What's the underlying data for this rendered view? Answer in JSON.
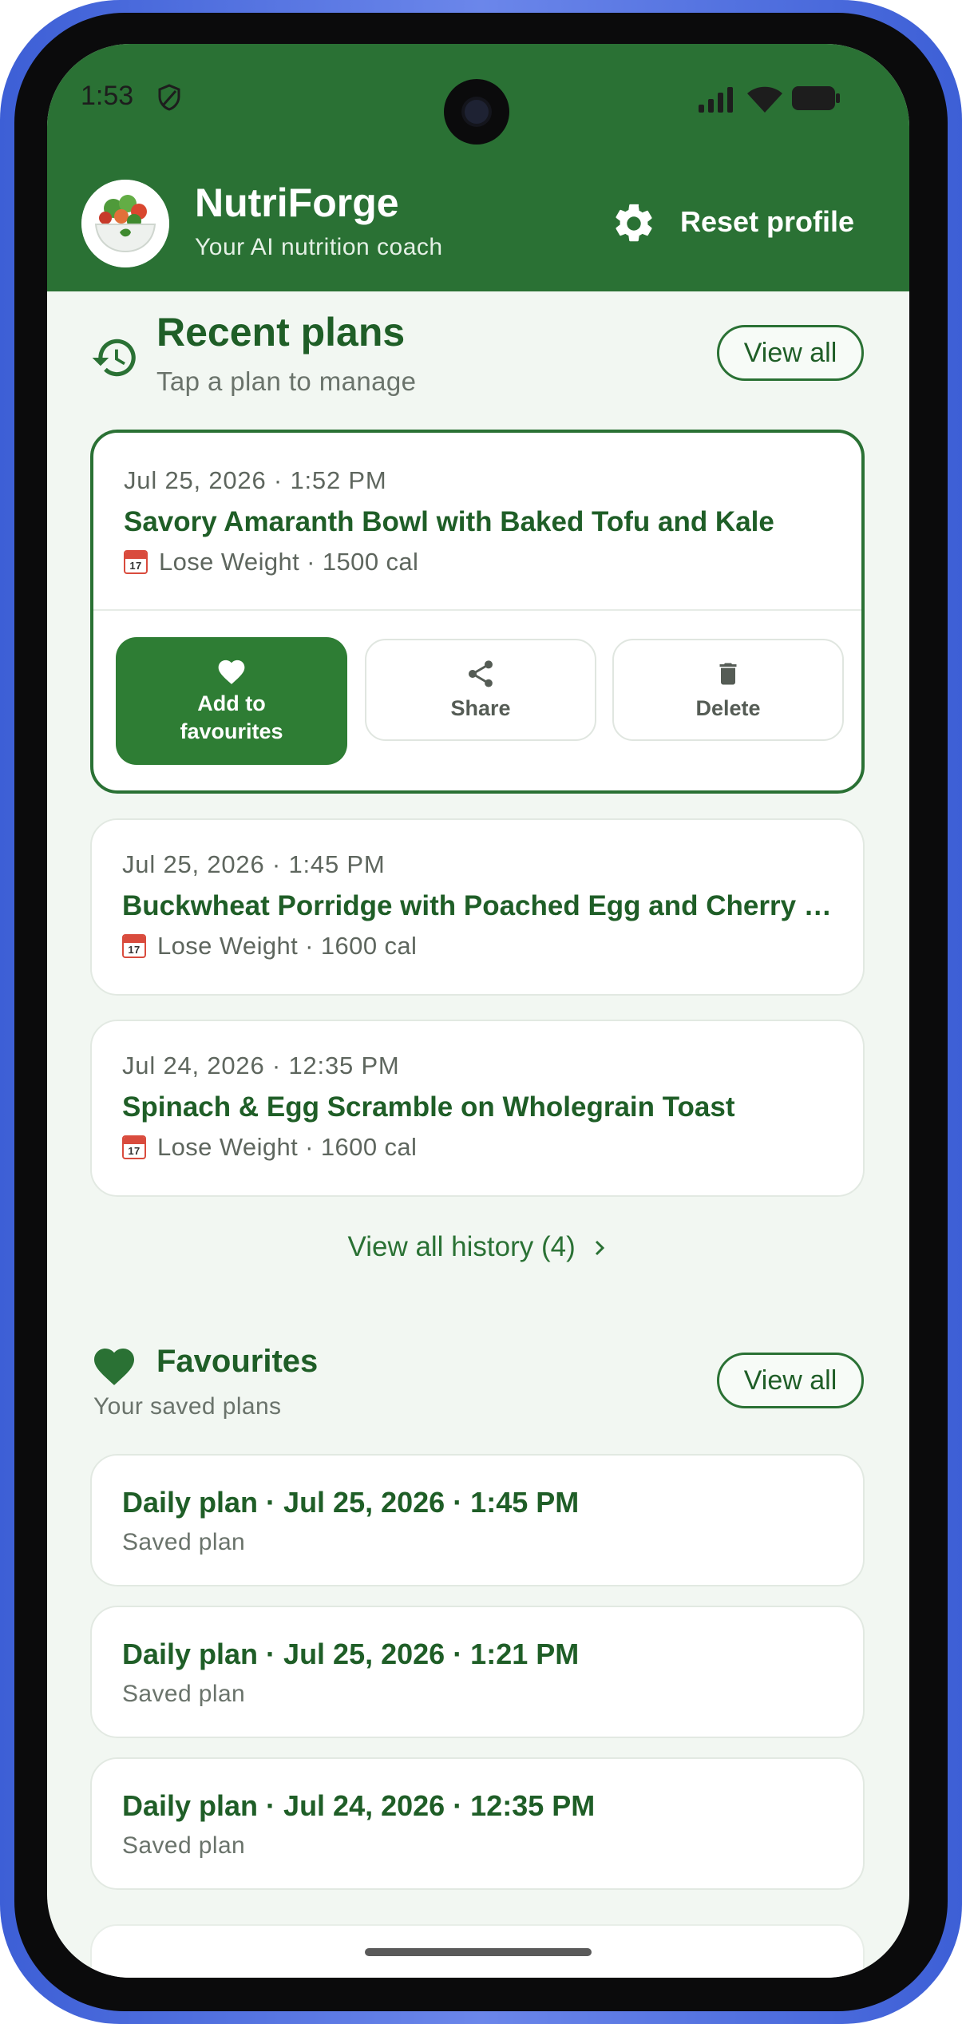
{
  "status_bar": {
    "time": "1:53"
  },
  "header": {
    "app_name": "NutriForge",
    "tagline": "Your AI nutrition coach",
    "reset_label": "Reset profile"
  },
  "recent": {
    "title": "Recent plans",
    "subtitle": "Tap a plan to manage",
    "view_all_label": "View all",
    "plans": [
      {
        "date": "Jul 25, 2026 · 1:52 PM",
        "title": "Savory Amaranth Bowl with Baked Tofu and Kale",
        "meta": "Lose Weight · 1500 cal"
      },
      {
        "date": "Jul 25, 2026 · 1:45 PM",
        "title": "Buckwheat Porridge with Poached Egg and Cherry T…",
        "meta": "Lose Weight · 1600 cal"
      },
      {
        "date": "Jul 24, 2026 · 12:35 PM",
        "title": "Spinach & Egg Scramble on Wholegrain Toast",
        "meta": "Lose Weight · 1600 cal"
      }
    ],
    "actions": {
      "favourite_label": "Add to favourites",
      "share_label": "Share",
      "delete_label": "Delete"
    },
    "history_link": "View all history (4)"
  },
  "favourites": {
    "title": "Favourites",
    "subtitle": "Your saved plans",
    "view_all_label": "View all",
    "items": [
      {
        "title": "Daily plan · Jul 25, 2026 · 1:45 PM",
        "subtitle": "Saved plan"
      },
      {
        "title": "Daily plan · Jul 25, 2026 · 1:21 PM",
        "subtitle": "Saved plan"
      },
      {
        "title": "Daily plan · Jul 24, 2026 · 12:35 PM",
        "subtitle": "Saved plan"
      }
    ]
  },
  "calendar_icon_text": "17",
  "colors": {
    "primary": "#2a7134",
    "primary_dark": "#1f5e27",
    "background": "#f2f7f2",
    "frame": "#3d5fd6"
  },
  "icons": [
    "history-icon",
    "heart-icon",
    "share-icon",
    "trash-icon",
    "gear-icon",
    "calendar-icon",
    "chevron-right-icon"
  ]
}
